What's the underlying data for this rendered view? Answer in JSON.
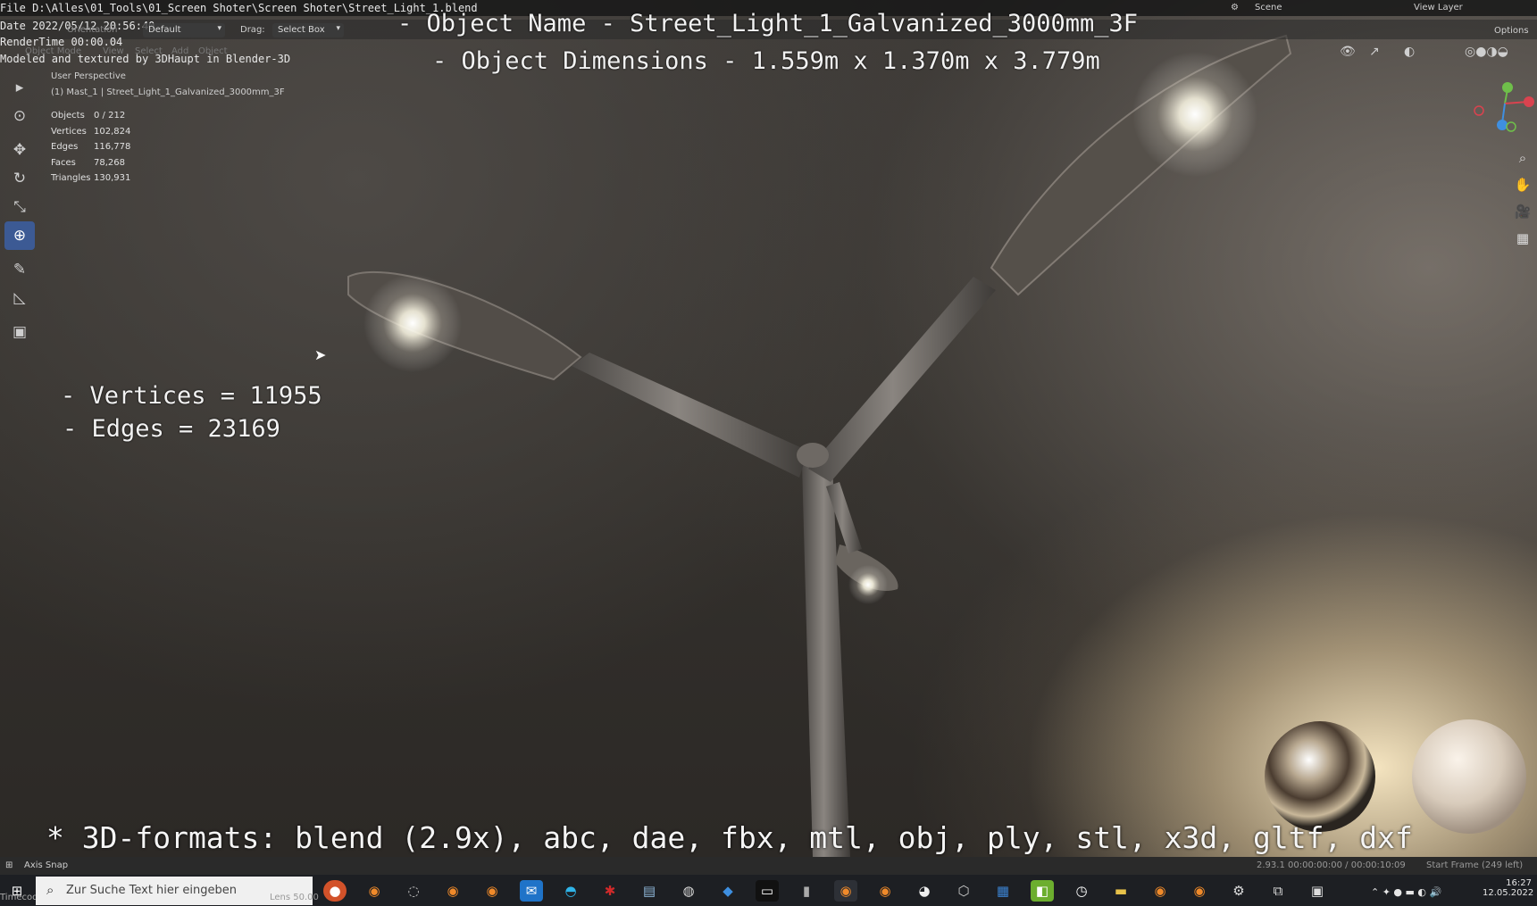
{
  "overlay": {
    "file_line": "File D:\\Alles\\01_Tools\\01_Screen Shoter\\Screen Shoter\\Street_Light_1.blend",
    "date_line": "Date 2022/05/12 20:56:40",
    "rendertime_line": "RenderTime 00:00.04",
    "credit_line": "Modeled and textured by 3DHaupt in Blender-3D",
    "object_name": "- Object Name - Street_Light_1_Galvanized_3000mm_3F",
    "object_dimensions": "- Object Dimensions -  1.559m x 1.370m x 3.779m",
    "vertices_line": "- Vertices = 11955",
    "edges_line": "- Edges = 23169",
    "formats_line": "* 3D-formats: blend (2.9x), abc, dae, fbx, mtl, obj, ply, stl, x3d, gltf, dxf"
  },
  "header": {
    "orientation_label": "Orientation",
    "pivot_label": "Default",
    "drag_label": "Drag:",
    "drag_value": "Select Box",
    "mode_label": "Object Mode",
    "menu_items": [
      "View",
      "Select",
      "Add",
      "Object"
    ],
    "scene_label": "Scene",
    "view_layer_label": "View Layer",
    "options_label": "Options"
  },
  "viewport_info": {
    "perspective": "User Perspective",
    "collection": "(1) Mast_1 | Street_Light_1_Galvanized_3000mm_3F",
    "stats": [
      {
        "label": "Objects",
        "value": "0 / 212"
      },
      {
        "label": "Vertices",
        "value": "102,824"
      },
      {
        "label": "Edges",
        "value": "116,778"
      },
      {
        "label": "Faces",
        "value": "78,268"
      },
      {
        "label": "Triangles",
        "value": "130,931"
      }
    ]
  },
  "left_tools": [
    {
      "name": "select-box-tool",
      "icon": "▸"
    },
    {
      "name": "cursor-tool",
      "icon": "⊙"
    },
    {
      "name": "move-tool",
      "icon": "✥"
    },
    {
      "name": "rotate-tool",
      "icon": "↻"
    },
    {
      "name": "scale-tool",
      "icon": "⤡"
    },
    {
      "name": "transform-tool",
      "icon": "⊕"
    },
    {
      "name": "annotate-tool",
      "icon": "✎"
    },
    {
      "name": "measure-tool",
      "icon": "◺"
    },
    {
      "name": "add-cube-tool",
      "icon": "▣"
    }
  ],
  "right_nav": [
    {
      "name": "zoom-icon",
      "icon": "⌕"
    },
    {
      "name": "hand-pan-icon",
      "icon": "✋"
    },
    {
      "name": "camera-icon",
      "icon": "🎥"
    },
    {
      "name": "grid-view-icon",
      "icon": "▦"
    }
  ],
  "status": {
    "left": "Axis Snap",
    "version": "2.93.1  00:00:00:00 / 00:00:10:09",
    "frame": "Start Frame (249 left)",
    "timecode": "Timecode",
    "lens": "Lens 50.00"
  },
  "taskbar": {
    "search_placeholder": "Zur Suche Text hier eingeben",
    "time": "16:27",
    "date": "12.05.2022"
  },
  "colors": {
    "active_tool": "#3c5a94",
    "taskbar": "#1d1f23"
  }
}
